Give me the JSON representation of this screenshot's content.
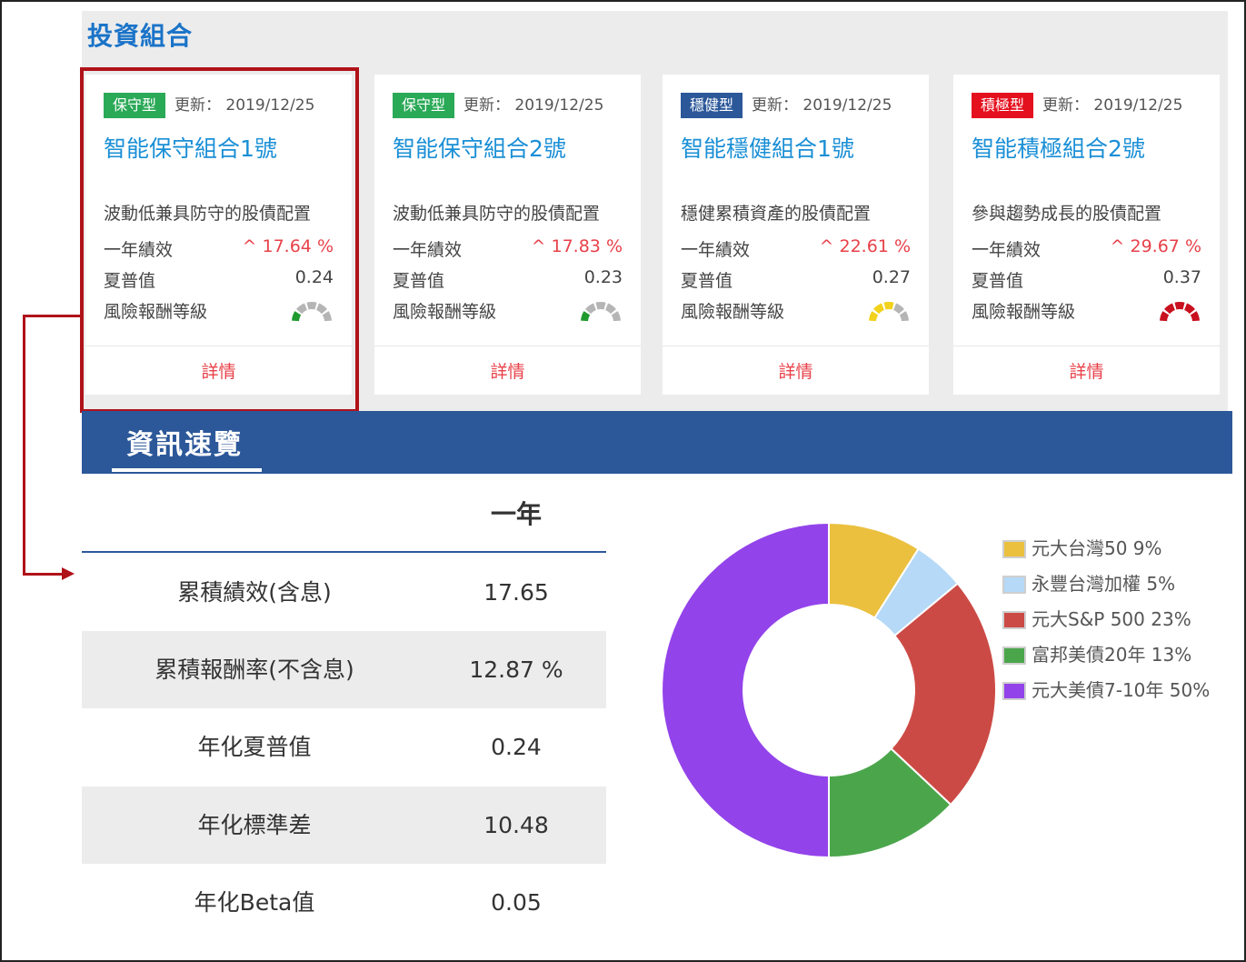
{
  "page": {
    "section_title": "投資組合",
    "update_label": "更新：",
    "detail_label": "詳情",
    "labels": {
      "perf": "一年績效",
      "sharpe": "夏普值",
      "risk": "風險報酬等級"
    }
  },
  "cards": [
    {
      "badge": "保守型",
      "badge_color": "#2aa957",
      "date": "2019/12/25",
      "name": "智能保守組合1號",
      "desc": "波動低兼具防守的股債配置",
      "perf": "^ 17.64 %",
      "sharpe": "0.24",
      "gauge_level": 1,
      "gauge_color": "#1f9a2f"
    },
    {
      "badge": "保守型",
      "badge_color": "#2aa957",
      "date": "2019/12/25",
      "name": "智能保守組合2號",
      "desc": "波動低兼具防守的股債配置",
      "perf": "^ 17.83 %",
      "sharpe": "0.23",
      "gauge_level": 1,
      "gauge_color": "#1f9a2f"
    },
    {
      "badge": "穩健型",
      "badge_color": "#2c5899",
      "date": "2019/12/25",
      "name": "智能穩健組合1號",
      "desc": "穩健累積資產的股債配置",
      "perf": "^ 22.61 %",
      "sharpe": "0.27",
      "gauge_level": 3,
      "gauge_color": "#f2d21b"
    },
    {
      "badge": "積極型",
      "badge_color": "#e5101e",
      "date": "2019/12/25",
      "name": "智能積極組合2號",
      "desc": "參與趨勢成長的股債配置",
      "perf": "^ 29.67 %",
      "sharpe": "0.37",
      "gauge_level": 5,
      "gauge_color": "#c8101e"
    }
  ],
  "info": {
    "tab_label": "資訊速覽",
    "column_header": "一年",
    "rows": [
      {
        "label": "累積績效(含息)",
        "value": "17.65"
      },
      {
        "label": "累積報酬率(不含息)",
        "value": "12.87 %"
      },
      {
        "label": "年化夏普值",
        "value": "0.24"
      },
      {
        "label": "年化標準差",
        "value": "10.48"
      },
      {
        "label": "年化Beta值",
        "value": "0.05"
      }
    ]
  },
  "chart_data": {
    "type": "pie",
    "subtype": "donut",
    "legend_position": "right",
    "slices": [
      {
        "label": "元大台灣50 9%",
        "value": 9,
        "color": "#ebc03f"
      },
      {
        "label": "永豐台灣加權 5%",
        "value": 5,
        "color": "#b5d9f7"
      },
      {
        "label": "元大S&P 500 23%",
        "value": 23,
        "color": "#cc4a45"
      },
      {
        "label": "富邦美債20年 13%",
        "value": 13,
        "color": "#4ba64b"
      },
      {
        "label": "元大美債7-10年 50%",
        "value": 50,
        "color": "#9343ea"
      }
    ]
  }
}
